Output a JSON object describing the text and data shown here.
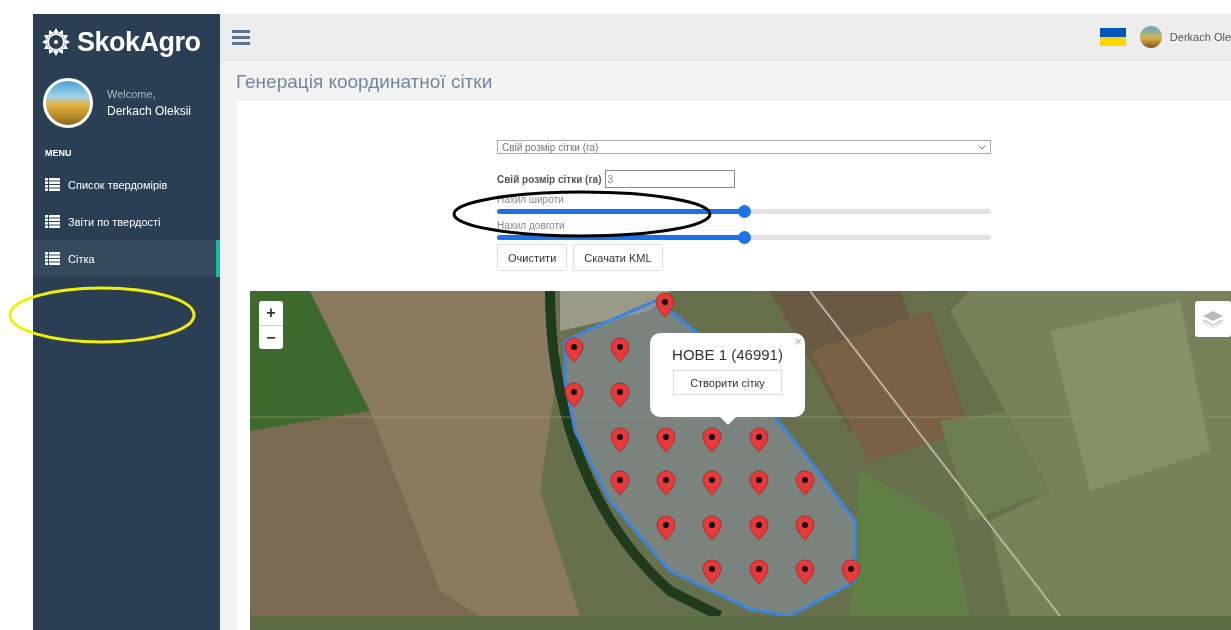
{
  "sidebar": {
    "brand": "SkokAgro",
    "welcome": "Welcome,",
    "user": "Derkach Oleksii",
    "menu_heading": "MENU",
    "items": [
      {
        "label": "Список твердомірів",
        "selected": false
      },
      {
        "label": "Звіти по твердості",
        "selected": false
      },
      {
        "label": "Сітка",
        "selected": true
      }
    ]
  },
  "top_bar": {
    "user": "Derkach Ole"
  },
  "page_title": "Генерація координатної сітки",
  "form": {
    "grid_select": "Свій розмір сітки (га)",
    "size_label": "Свій розмір сітки (га)",
    "size_value": "3",
    "sliders": [
      {
        "label": "Нахил широти",
        "level": 0.5
      },
      {
        "label": "Нахил довготи",
        "level": 0.5
      }
    ],
    "buttons": [
      "Очистити",
      "Скачати KML"
    ]
  },
  "map": {
    "zoom_in": "+",
    "zoom_out": "−",
    "popup": {
      "title": "НОВЕ 1 (46991)",
      "close": "×",
      "button": "Створити сітку"
    }
  },
  "annotations": [
    {
      "color": "#000000"
    },
    {
      "color": "#f2ef00"
    }
  ]
}
